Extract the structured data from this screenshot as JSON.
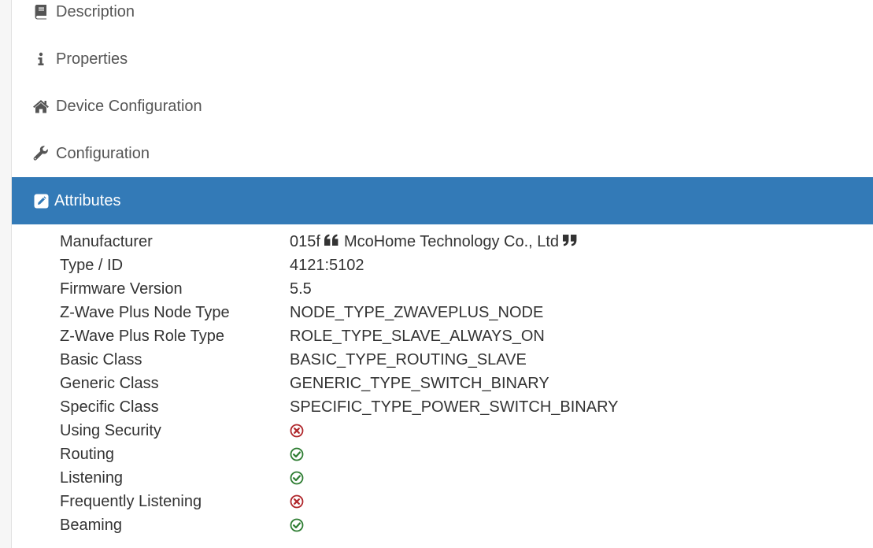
{
  "nav": {
    "items": [
      {
        "label": "Description",
        "icon": "book-icon"
      },
      {
        "label": "Properties",
        "icon": "info-icon"
      },
      {
        "label": "Device Configuration",
        "icon": "home-icon"
      },
      {
        "label": "Configuration",
        "icon": "wrench-icon"
      },
      {
        "label": "Attributes",
        "icon": "edit-icon",
        "active": true
      }
    ]
  },
  "attributes": {
    "manufacturer": {
      "label": "Manufacturer",
      "code": "015f",
      "name": "McoHome Technology Co., Ltd"
    },
    "type_id": {
      "label": "Type / ID",
      "value": "4121:5102"
    },
    "firmware": {
      "label": "Firmware Version",
      "value": "5.5"
    },
    "node_type": {
      "label": "Z-Wave Plus Node Type",
      "value": "NODE_TYPE_ZWAVEPLUS_NODE"
    },
    "role_type": {
      "label": "Z-Wave Plus Role Type",
      "value": "ROLE_TYPE_SLAVE_ALWAYS_ON"
    },
    "basic_class": {
      "label": "Basic Class",
      "value": "BASIC_TYPE_ROUTING_SLAVE"
    },
    "generic_class": {
      "label": "Generic Class",
      "value": "GENERIC_TYPE_SWITCH_BINARY"
    },
    "specific_class": {
      "label": "Specific Class",
      "value": "SPECIFIC_TYPE_POWER_SWITCH_BINARY"
    },
    "using_security": {
      "label": "Using Security",
      "value": false
    },
    "routing": {
      "label": "Routing",
      "value": true
    },
    "listening": {
      "label": "Listening",
      "value": true
    },
    "frequently_listening": {
      "label": "Frequently Listening",
      "value": false
    },
    "beaming": {
      "label": "Beaming",
      "value": true
    }
  },
  "colors": {
    "accent": "#337ab7",
    "yes": "#2e7d32",
    "no": "#b0262b"
  }
}
